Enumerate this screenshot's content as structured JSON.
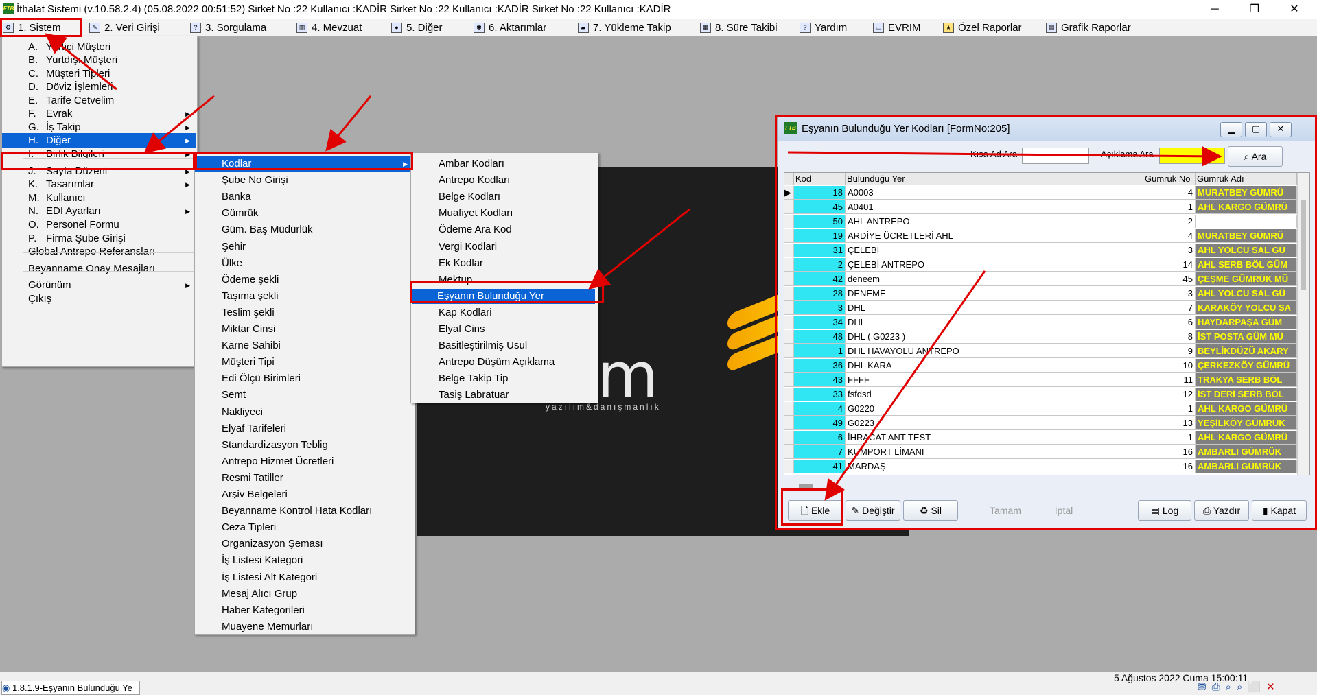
{
  "window": {
    "title": "İthalat Sistemi (v.10.58.2.4) (05.08.2022 00:51:52) Sirket No :22 Kullanıcı :KADİR Sirket No :22 Kullanıcı :KADİR Sirket No :22 Kullanıcı :KADİR",
    "logo_text": "FTB",
    "min": "─",
    "max": "❐",
    "close": "✕"
  },
  "menubar": [
    "1.  Sistem",
    "2.  Veri Girişi",
    "3.  Sorgulama",
    "4.  Mevzuat",
    "5.  Diğer",
    "6.  Aktarımlar",
    "7.  Yükleme Takip",
    "8. Süre Takibi",
    "Yardım",
    "EVRIM",
    "Özel Raporlar",
    "Grafik Raporlar"
  ],
  "sistem_menu": [
    {
      "key": "A.",
      "label": "Yurtiçi Müşteri"
    },
    {
      "key": "B.",
      "label": "Yurtdışı Müşteri"
    },
    {
      "key": "C.",
      "label": "Müşteri Tipleri"
    },
    {
      "key": "D.",
      "label": "Döviz İşlemleri"
    },
    {
      "key": "E.",
      "label": "Tarife Cetvelim"
    },
    {
      "key": "F.",
      "label": "Evrak"
    },
    {
      "key": "G.",
      "label": "İş Takip"
    },
    {
      "key": "H.",
      "label": "Diğer"
    },
    {
      "key": "I.",
      "label": "Birlik Bilgileri"
    },
    {
      "key": "J.",
      "label": "Sayfa Düzeni"
    },
    {
      "key": "K.",
      "label": "Tasarımlar"
    },
    {
      "key": "M.",
      "label": "Kullanıcı"
    },
    {
      "key": "N.",
      "label": "EDI Ayarları"
    },
    {
      "key": "O.",
      "label": "Personel Formu"
    },
    {
      "key": "P.",
      "label": "Firma Şube Girişi"
    },
    {
      "key": "",
      "label": "Global Antrepo Referansları"
    },
    {
      "key": "",
      "label": "Beyanname Onay Mesajları"
    },
    {
      "key": "",
      "label": "Görünüm"
    },
    {
      "key": "",
      "label": "Çıkış"
    }
  ],
  "diger_menu": [
    "Kodlar",
    "Şube No Girişi",
    "Banka",
    "Gümrük",
    "Güm. Baş Müdürlük",
    "Şehir",
    "Ülke",
    "Ödeme şekli",
    "Taşıma şekli",
    "Teslim şekli",
    "Miktar Cinsi",
    "Karne Sahibi",
    "Müşteri  Tipi",
    "Edi Ölçü Birimleri",
    "Semt",
    "Nakliyeci",
    "Elyaf Tarifeleri",
    "Standardizasyon Teblig",
    "Antrepo Hizmet Ücretleri",
    "Resmi Tatiller",
    "Arşiv Belgeleri",
    "Beyanname Kontrol Hata Kodları",
    "Ceza Tipleri",
    "Organizasyon Şeması",
    "İş Listesi Kategori",
    "İş Listesi Alt Kategori",
    "Mesaj Alıcı Grup",
    "Haber Kategorileri",
    "Muayene Memurları"
  ],
  "kodlar_menu": [
    "Ambar Kodları",
    "Antrepo Kodları",
    "Belge Kodları",
    "Muafiyet Kodları",
    "Ödeme Ara Kod",
    "Vergi Kodlari",
    "Ek Kodlar",
    "Mektup",
    "Eşyanın Bulunduğu Yer",
    "Kap Kodlari",
    "Elyaf Cins",
    "Basitleştirilmiş Usul",
    "Antrepo Düşüm Açıklama",
    "Belge Takip Tip",
    "Tasiş Labratuar"
  ],
  "splash": {
    "brand": "vrim",
    "tagline": "yazılım&danışmanlık"
  },
  "form": {
    "title": "Eşyanın Bulunduğu Yer Kodları [FormNo:205]",
    "logo_text": "FTB",
    "kisa_ad_label": "Kısa Ad Ara",
    "kisa_ad_value": "",
    "aciklama_label": "Açıklama Ara",
    "aciklama_value": "",
    "ara_button": "Ara",
    "columns": [
      "Kod",
      "Bulunduğu Yer",
      "Gumruk No",
      "Gümrük Adı"
    ],
    "rows": [
      {
        "kod": "18",
        "yer": "A0003",
        "gno": "4",
        "gad": "MURATBEY GÜMRÜ"
      },
      {
        "kod": "45",
        "yer": "A0401",
        "gno": "1",
        "gad": "AHL KARGO GÜMRÜ"
      },
      {
        "kod": "50",
        "yer": "AHL ANTREPO",
        "gno": "2",
        "gad": ""
      },
      {
        "kod": "19",
        "yer": "ARDİYE ÜCRETLERİ AHL",
        "gno": "4",
        "gad": "MURATBEY GÜMRÜ"
      },
      {
        "kod": "31",
        "yer": "ÇELEBİ",
        "gno": "3",
        "gad": "AHL YOLCU SAL GÜ"
      },
      {
        "kod": "2",
        "yer": "ÇELEBİ ANTREPO",
        "gno": "14",
        "gad": "AHL SERB BÖL GÜM"
      },
      {
        "kod": "42",
        "yer": "deneem",
        "gno": "45",
        "gad": "ÇEŞME GÜMRÜK MÜ"
      },
      {
        "kod": "28",
        "yer": "DENEME",
        "gno": "3",
        "gad": "AHL YOLCU SAL GÜ"
      },
      {
        "kod": "3",
        "yer": "DHL",
        "gno": "7",
        "gad": "KARAKÖY YOLCU SA"
      },
      {
        "kod": "34",
        "yer": "DHL",
        "gno": "6",
        "gad": "HAYDARPAŞA GÜM"
      },
      {
        "kod": "48",
        "yer": "DHL ( G0223 )",
        "gno": "8",
        "gad": "İST POSTA GÜM MÜ"
      },
      {
        "kod": "1",
        "yer": "DHL HAVAYOLU ANTREPO",
        "gno": "9",
        "gad": "BEYLİKDÜZÜ AKARY"
      },
      {
        "kod": "36",
        "yer": "DHL KARA",
        "gno": "10",
        "gad": "ÇERKEZKÖY GÜMRÜ"
      },
      {
        "kod": "43",
        "yer": "FFFF",
        "gno": "11",
        "gad": "TRAKYA SERB BÖL"
      },
      {
        "kod": "33",
        "yer": "fsfdsd",
        "gno": "12",
        "gad": "İST DERİ SERB BÖL"
      },
      {
        "kod": "4",
        "yer": "G0220",
        "gno": "1",
        "gad": "AHL KARGO GÜMRÜ"
      },
      {
        "kod": "49",
        "yer": "G0223",
        "gno": "13",
        "gad": "YEŞİLKÖY GÜMRÜK"
      },
      {
        "kod": "6",
        "yer": "İHRACAT ANT TEST",
        "gno": "1",
        "gad": "AHL KARGO GÜMRÜ"
      },
      {
        "kod": "7",
        "yer": "KUMPORT LİMANI",
        "gno": "16",
        "gad": "AMBARLI  GÜMRÜK"
      },
      {
        "kod": "41",
        "yer": "MARDAŞ",
        "gno": "16",
        "gad": "AMBARLI  GÜMRÜK"
      }
    ],
    "buttons": {
      "ekle": "Ekle",
      "degistir": "Değiştir",
      "sil": "Sil",
      "tamam": "Tamam",
      "iptal": "İptal",
      "log": "Log",
      "yazdir": "Yazdır",
      "kapat": "Kapat"
    }
  },
  "status": {
    "date_text": "5 Ağustos 2022 Cuma 15:00:11",
    "task_label": "1.8.1.9-Eşyanın Bulunduğu Ye"
  },
  "colors": {
    "highlight": "#0a64d6",
    "annotation": "#e00000",
    "kod_cell": "#2fe6f2",
    "gumruk_cell_bg": "#808080",
    "gumruk_cell_fg": "#ffff00"
  }
}
